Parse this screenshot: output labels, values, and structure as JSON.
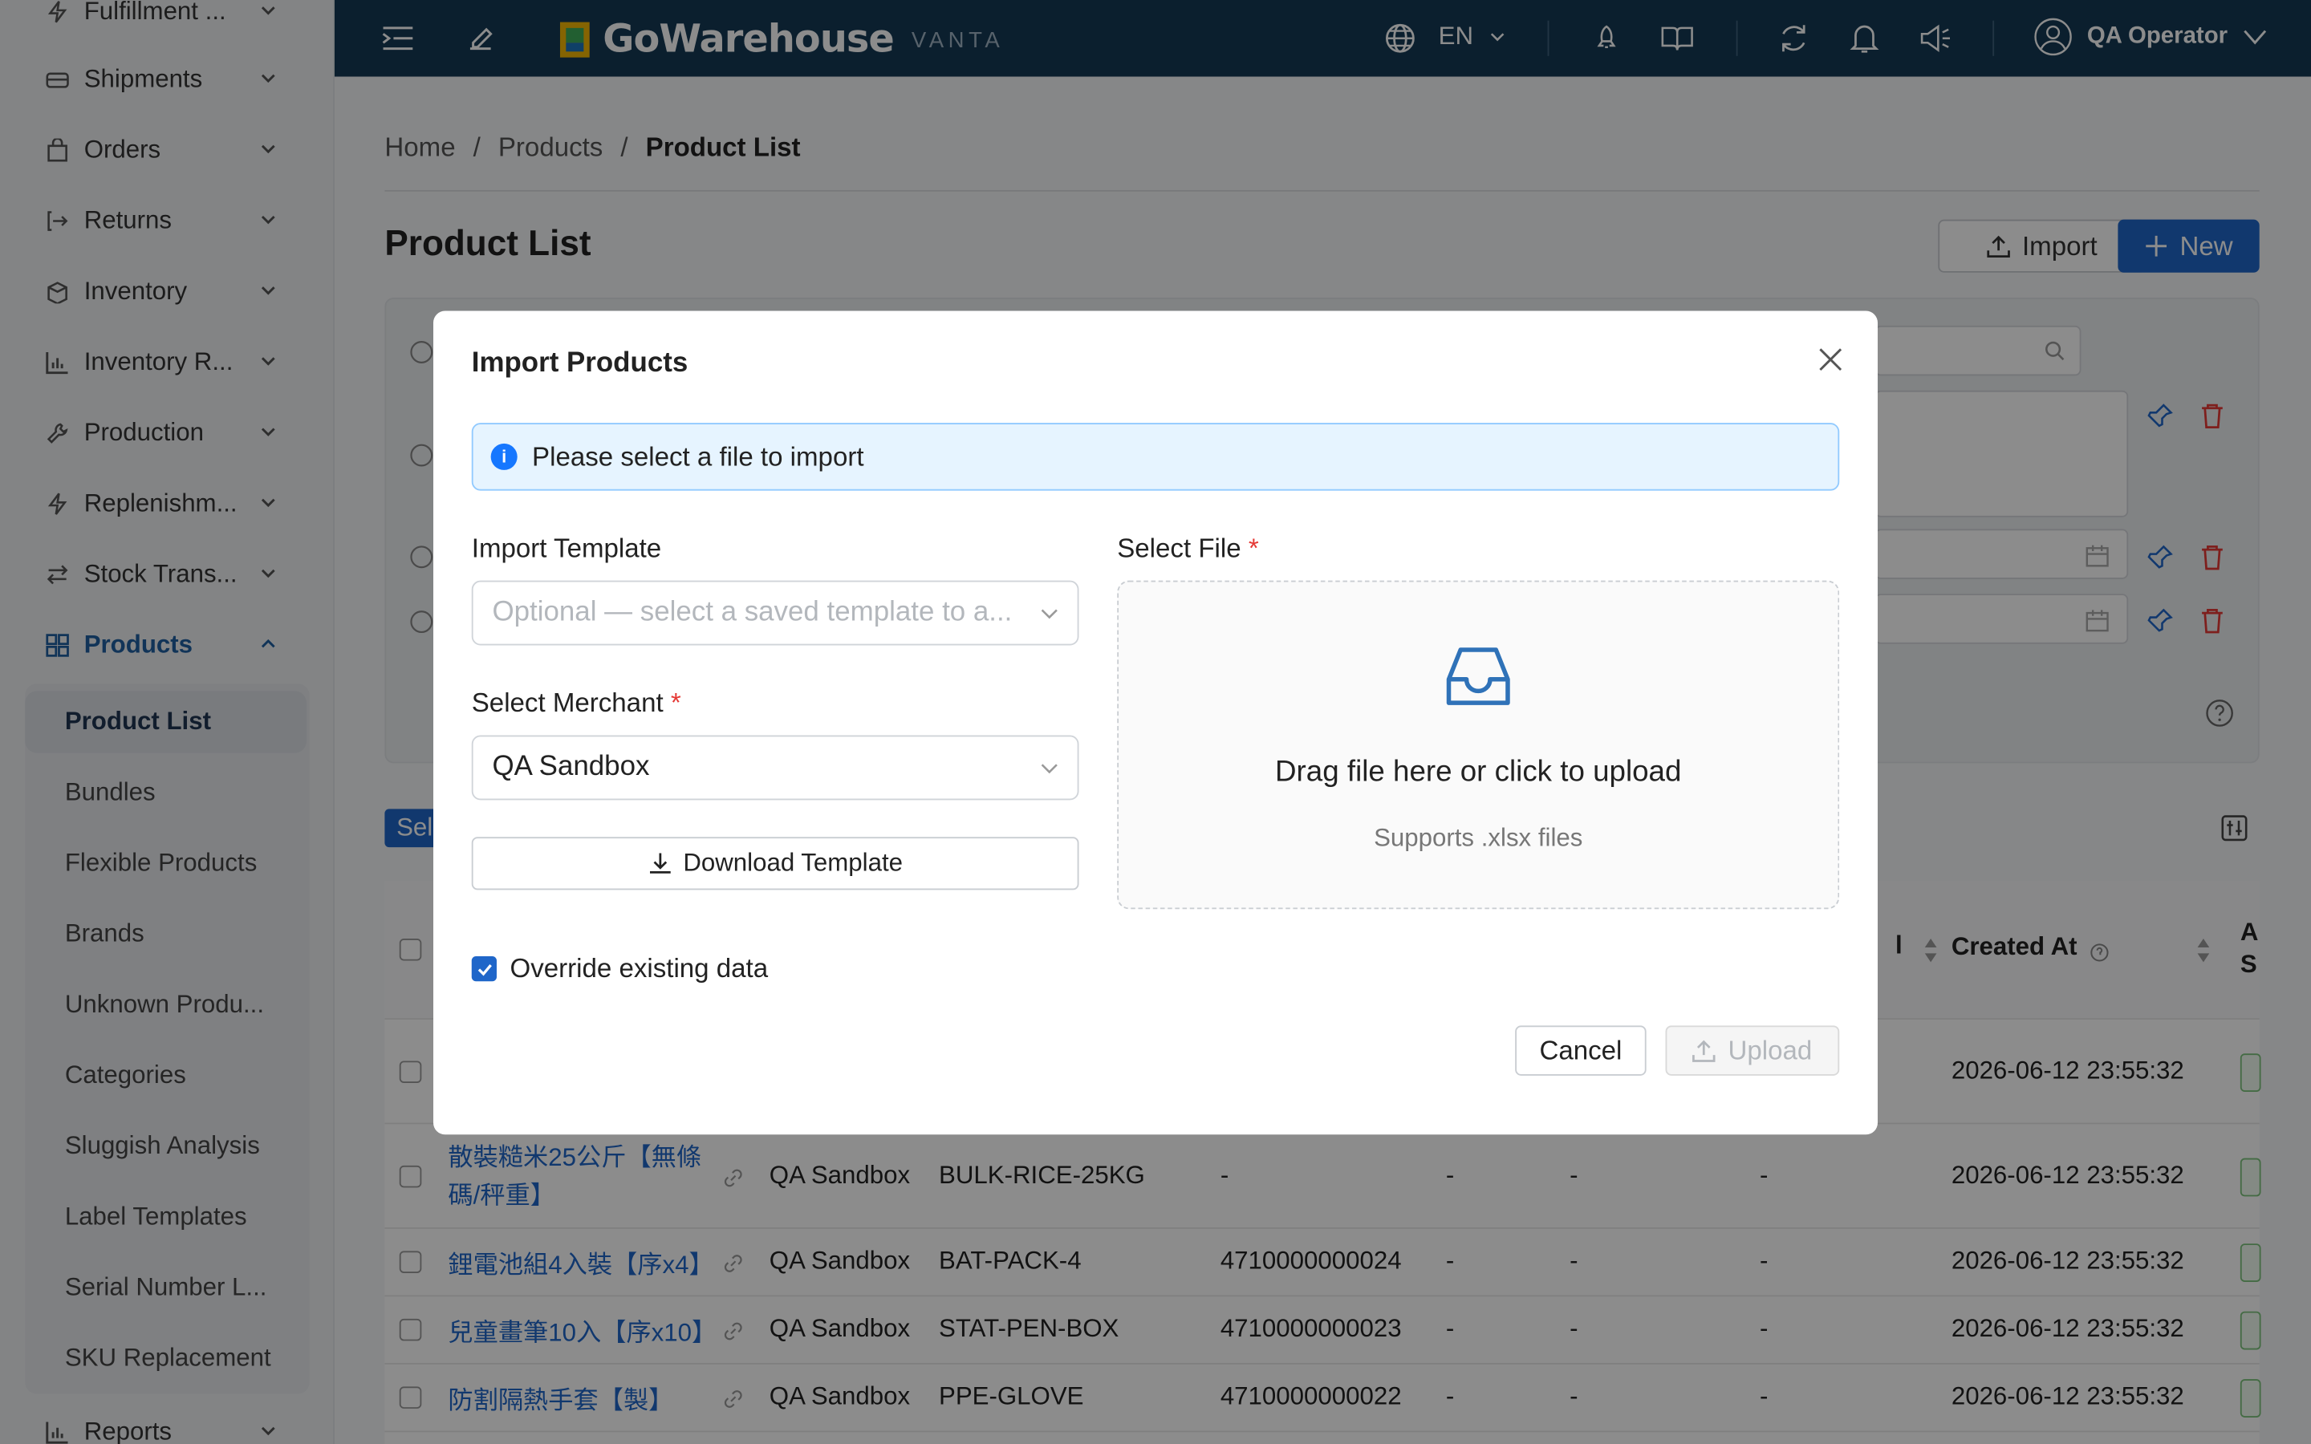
{
  "sidebar": {
    "items": [
      {
        "label": "Fulfillment ...",
        "icon": "bolt-icon"
      },
      {
        "label": "Shipments",
        "icon": "truck-icon"
      },
      {
        "label": "Orders",
        "icon": "bag-icon"
      },
      {
        "label": "Returns",
        "icon": "return-icon"
      },
      {
        "label": "Inventory",
        "icon": "box-icon"
      },
      {
        "label": "Inventory R...",
        "icon": "bar-chart-icon"
      },
      {
        "label": "Production",
        "icon": "wrench-icon"
      },
      {
        "label": "Replenishm...",
        "icon": "bolt-icon"
      },
      {
        "label": "Stock Trans...",
        "icon": "transfer-icon"
      },
      {
        "label": "Products",
        "icon": "grid-icon"
      }
    ],
    "products_sub": [
      {
        "label": "Product List"
      },
      {
        "label": "Bundles"
      },
      {
        "label": "Flexible Products"
      },
      {
        "label": "Brands"
      },
      {
        "label": "Unknown Produ..."
      },
      {
        "label": "Categories"
      },
      {
        "label": "Sluggish Analysis"
      },
      {
        "label": "Label Templates"
      },
      {
        "label": "Serial Number L..."
      },
      {
        "label": "SKU Replacement"
      }
    ],
    "reports": {
      "label": "Reports",
      "icon": "bar-chart-icon"
    }
  },
  "topbar": {
    "brand": "GoWarehouse",
    "brand_suffix": "VANTA",
    "language": "EN",
    "user": "QA Operator"
  },
  "breadcrumb": {
    "home": "Home",
    "sep": "/",
    "products": "Products",
    "current": "Product List"
  },
  "page": {
    "title": "Product List",
    "import_label": "Import",
    "new_label": "New",
    "select_tag": "Sel"
  },
  "table": {
    "created_at_header": "Created At",
    "partial_header_left": "l",
    "partial_header_right": "A\nS",
    "rows": [
      {
        "name": "",
        "merchant": "",
        "sku": "",
        "barcode": "",
        "c1": "",
        "c2": "",
        "c3": "",
        "created": "2026-06-12 23:55:32"
      },
      {
        "name": "散裝糙米25公斤【無條碼/秤重】",
        "merchant": "QA Sandbox",
        "sku": "BULK-RICE-25KG",
        "barcode": "-",
        "c1": "-",
        "c2": "-",
        "c3": "-",
        "created": "2026-06-12 23:55:32"
      },
      {
        "name": "鋰電池組4入裝【序x4】",
        "merchant": "QA Sandbox",
        "sku": "BAT-PACK-4",
        "barcode": "4710000000024",
        "c1": "-",
        "c2": "-",
        "c3": "-",
        "created": "2026-06-12 23:55:32"
      },
      {
        "name": "兒童畫筆10入【序x10】",
        "merchant": "QA Sandbox",
        "sku": "STAT-PEN-BOX",
        "barcode": "4710000000023",
        "c1": "-",
        "c2": "-",
        "c3": "-",
        "created": "2026-06-12 23:55:32"
      },
      {
        "name": "防割隔熱手套【製】",
        "merchant": "QA Sandbox",
        "sku": "PPE-GLOVE",
        "barcode": "4710000000022",
        "c1": "-",
        "c2": "-",
        "c3": "-",
        "created": "2026-06-12 23:55:32"
      }
    ]
  },
  "modal": {
    "title": "Import Products",
    "alert": "Please select a file to import",
    "template_label": "Import Template",
    "template_placeholder": "Optional — select a saved template to a...",
    "merchant_label": "Select Merchant",
    "merchant_value": "QA Sandbox",
    "download_label": "Download Template",
    "file_label": "Select File",
    "drag_text": "Drag file here or click to upload",
    "supports_text": "Supports .xlsx files",
    "override_label": "Override existing data",
    "override_checked": true,
    "cancel_label": "Cancel",
    "upload_label": "Upload",
    "required_mark": "*"
  },
  "colors": {
    "topbar": "#143a55",
    "primary": "#1f66c9",
    "alert_bg": "#e6f4ff",
    "danger": "#e53935"
  }
}
